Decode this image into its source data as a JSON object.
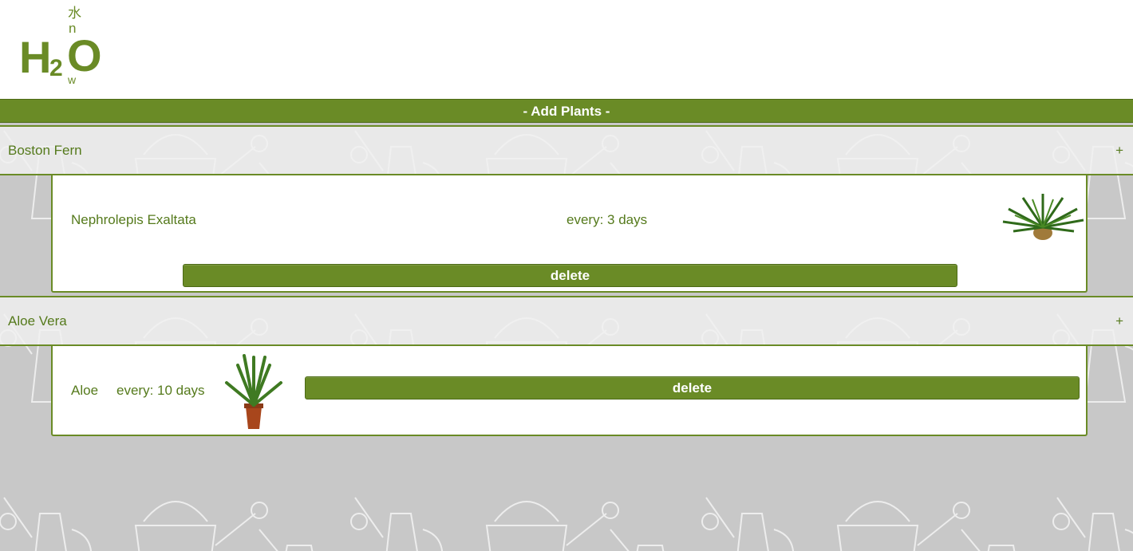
{
  "logo": {
    "big": "H",
    "sub": "2",
    "big2": "O",
    "top_char": "水",
    "top_small": "n",
    "bottom_small": "w",
    "alt": "H2O now"
  },
  "add_plants_label": "- Add Plants -",
  "plants": [
    {
      "name": "Boston Fern",
      "expand_label": "+",
      "scientific_name": "Nephrolepis Exaltata",
      "frequency": "every: 3 days",
      "delete_label": "delete",
      "image": "fern-image"
    },
    {
      "name": "Aloe Vera",
      "expand_label": "+",
      "scientific_name": "Aloe",
      "frequency": "every: 10 days",
      "delete_label": "delete",
      "image": "aloe-image"
    }
  ],
  "colors": {
    "brand_green": "#6a8b26",
    "text_green": "#557a1c",
    "background_gray": "#c8c8c8"
  }
}
